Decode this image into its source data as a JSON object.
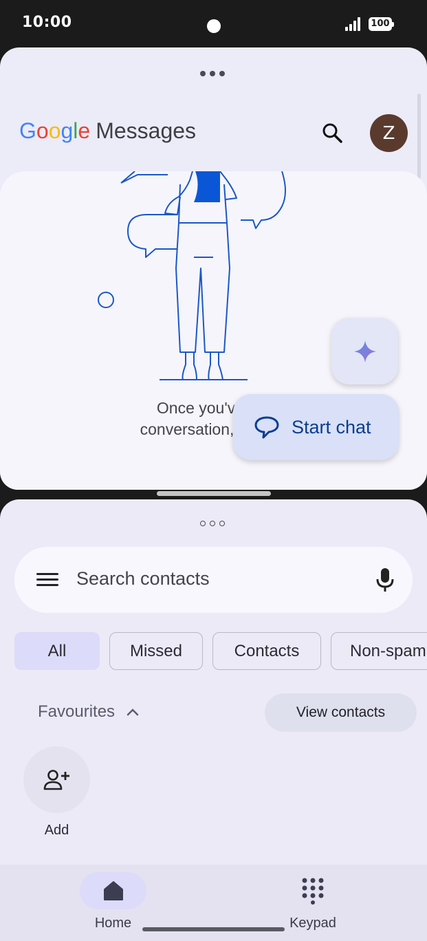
{
  "status_bar": {
    "time": "10:00",
    "battery": "100"
  },
  "messages_app": {
    "brand_google": [
      "G",
      "o",
      "o",
      "g",
      "l",
      "e"
    ],
    "brand_product": "Messages",
    "avatar_initial": "Z",
    "empty_state_line1": "Once you've sta",
    "empty_state_line2": "conversation, you'll s",
    "start_chat_label": "Start chat"
  },
  "phone_app": {
    "search_placeholder": "Search contacts",
    "filters": [
      "All",
      "Missed",
      "Contacts",
      "Non-spam"
    ],
    "active_filter": "All",
    "favourites_label": "Favourites",
    "view_contacts_label": "View contacts",
    "add_label": "Add",
    "nav": {
      "home": "Home",
      "keypad": "Keypad"
    }
  },
  "colors": {
    "accent": "#0b3d91",
    "chip_active": "#dcdbf9",
    "illustration_blue": "#1a57c9"
  }
}
